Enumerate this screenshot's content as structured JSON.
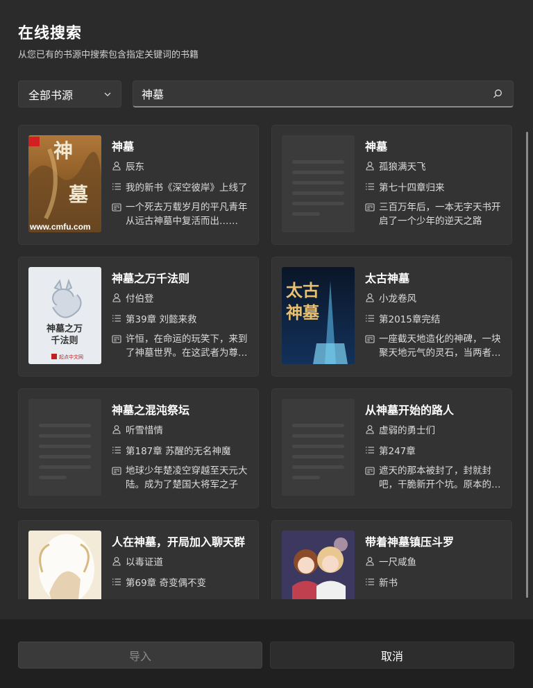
{
  "dialog": {
    "title": "在线搜索",
    "subtitle": "从您已有的书源中搜索包含指定关键词的书籍"
  },
  "source_select": {
    "selected": "全部书源"
  },
  "search": {
    "value": "神墓"
  },
  "results": [
    {
      "title": "神墓",
      "author": "辰东",
      "latest": "我的新书《深空彼岸》上线了",
      "intro": "一个死去万载岁月的平凡青年从远古神墓中复活而出……",
      "cover": "cover-painted-shenmu",
      "cover_text": "www.cmfu.com"
    },
    {
      "title": "神墓",
      "author": "孤狼满天飞",
      "latest": "第七十四章归来",
      "intro": "三百万年后，一本无字天书开启了一个少年的逆天之路",
      "cover": "placeholder"
    },
    {
      "title": "神墓之万千法则",
      "author": "付伯登",
      "latest": "第39章 刘懿来救",
      "intro": "许恒，在命运的玩笑下，来到了神墓世界。在这武者为尊的世界",
      "cover": "cover-qidian",
      "cover_text": "神墓之万千法则",
      "cover_text_lines": [
        "神墓之万",
        "千法则"
      ],
      "cover_brand": "起点中文网"
    },
    {
      "title": "太古神墓",
      "author": "小龙卷风",
      "latest": "第2015章完结",
      "intro": "一座截天地造化的神碑，一块聚天地元气的灵石，当两者合而为一",
      "cover": "cover-taigu",
      "cover_text": "太古神墓"
    },
    {
      "title": "神墓之混沌祭坛",
      "author": "听雪惜情",
      "latest": "第187章 苏醒的无名神魔",
      "intro": "地球少年楚凌空穿越至天元大陆。成为了楚国大将军之子",
      "cover": "placeholder"
    },
    {
      "title": "从神墓开始的路人",
      "author": "虚弱的勇士们",
      "latest": "第247章",
      "intro": "遮天的那本被封了，封就封吧，干脆新开个坑。原本的主角",
      "cover": "placeholder"
    },
    {
      "title": "人在神墓，开局加入聊天群",
      "author": "以毒证道",
      "latest": "第69章 奇变偶不变",
      "intro": "",
      "cover": "cover-light"
    },
    {
      "title": "带着神墓镇压斗罗",
      "author": "一尺咸鱼",
      "latest": "新书",
      "intro": "",
      "cover": "cover-anime"
    }
  ],
  "buttons": {
    "import": "导入",
    "cancel": "取消"
  },
  "colors": {
    "background": "#2b2b2b",
    "card": "#333333",
    "footer": "#202020",
    "accent_border": "#8a8a8a"
  }
}
